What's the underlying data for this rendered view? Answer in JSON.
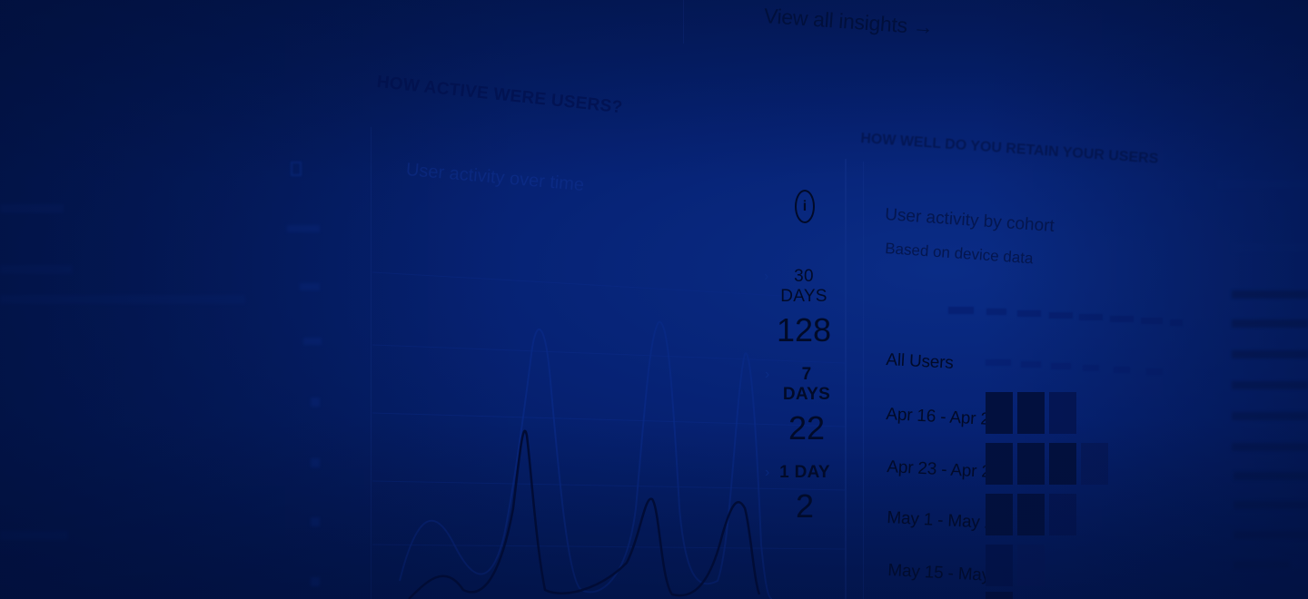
{
  "header": {
    "view_all_label": "View all insights →"
  },
  "activity_panel": {
    "title": "HOW ACTIVE WERE USERS?",
    "subtitle": "User activity over time",
    "info_icon": "info-icon",
    "stats": [
      {
        "label": "30 DAYS",
        "value": "128"
      },
      {
        "label": "7 DAYS",
        "value": "22"
      },
      {
        "label": "1 DAY",
        "value": "2"
      }
    ]
  },
  "retention_panel": {
    "title": "HOW WELL DO YOU RETAIN YOUR USERS",
    "chart_title": "User activity by cohort",
    "chart_subtitle": "Based on device data",
    "rows": [
      {
        "label": "All Users"
      },
      {
        "label": "Apr 16 - Apr 22"
      },
      {
        "label": "Apr 23 - Apr 29"
      },
      {
        "label": "May 1 - May 28"
      },
      {
        "label": "May 15 - May 21"
      }
    ]
  },
  "colors": {
    "background": "#041c61",
    "text_dark": "#010a28",
    "cell": "#02103e"
  }
}
